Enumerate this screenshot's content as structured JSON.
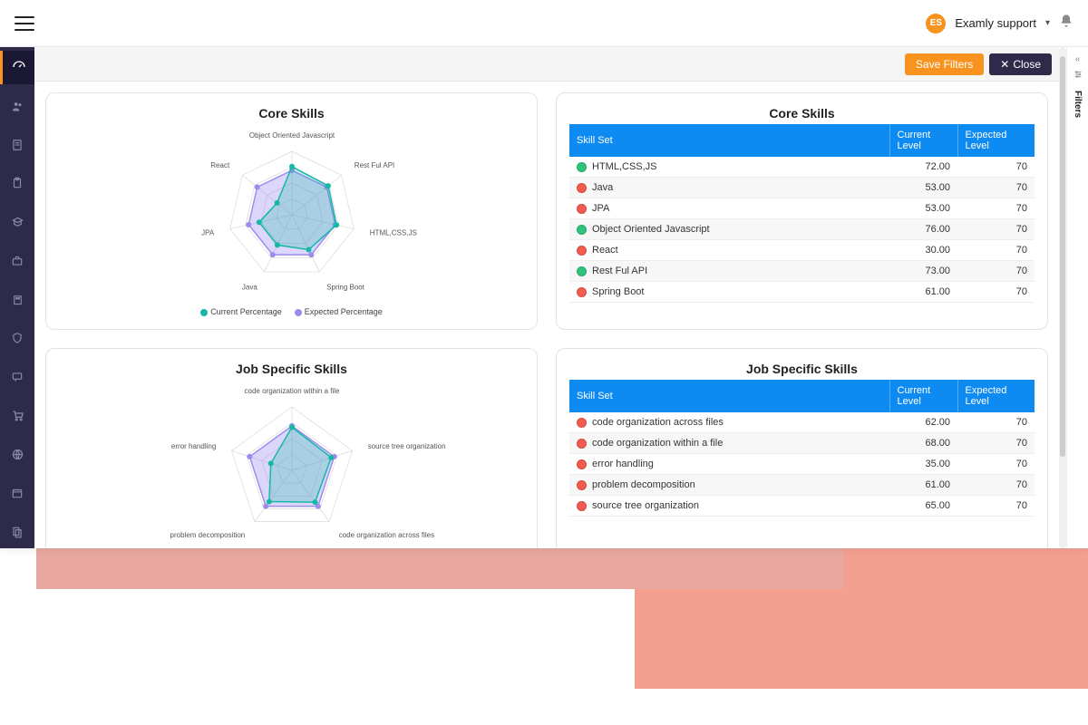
{
  "topbar": {
    "user_initials": "ES",
    "user_name": "Examly support"
  },
  "toolbar": {
    "save_label": "Save Filters",
    "close_label": "Close"
  },
  "filters_rail": {
    "label": "Filters"
  },
  "colors": {
    "current": "#15b8a6",
    "expected": "#9b8cf0",
    "header_blue": "#0d8bf2",
    "accent": "#f7931e",
    "sidebar": "#2e2b4a"
  },
  "legend": {
    "current": "Current Percentage",
    "expected": "Expected Percentage"
  },
  "core": {
    "title": "Core Skills",
    "table_title": "Core Skills",
    "headers": {
      "skill": "Skill Set",
      "current": "Current Level",
      "expected": "Expected Level"
    },
    "rows": [
      {
        "name": "HTML,CSS,JS",
        "current": 72.0,
        "expected": 70,
        "status": "green"
      },
      {
        "name": "Java",
        "current": 53.0,
        "expected": 70,
        "status": "red"
      },
      {
        "name": "JPA",
        "current": 53.0,
        "expected": 70,
        "status": "red"
      },
      {
        "name": "Object Oriented Javascript",
        "current": 76.0,
        "expected": 70,
        "status": "green"
      },
      {
        "name": "React",
        "current": 30.0,
        "expected": 70,
        "status": "red"
      },
      {
        "name": "Rest Ful API",
        "current": 73.0,
        "expected": 70,
        "status": "green"
      },
      {
        "name": "Spring Boot",
        "current": 61.0,
        "expected": 70,
        "status": "red"
      }
    ],
    "radar_order": [
      "Object Oriented Javascript",
      "Rest Ful API",
      "HTML,CSS,JS",
      "Spring Boot",
      "Java",
      "JPA",
      "React"
    ]
  },
  "job": {
    "title": "Job Specific Skills",
    "table_title": "Job Specific Skills",
    "headers": {
      "skill": "Skill Set",
      "current": "Current Level",
      "expected": "Expected Level"
    },
    "rows": [
      {
        "name": "code organization across files",
        "current": 62.0,
        "expected": 70,
        "status": "red"
      },
      {
        "name": "code organization within a file",
        "current": 68.0,
        "expected": 70,
        "status": "red"
      },
      {
        "name": "error handling",
        "current": 35.0,
        "expected": 70,
        "status": "red"
      },
      {
        "name": "problem decomposition",
        "current": 61.0,
        "expected": 70,
        "status": "red"
      },
      {
        "name": "source tree organization",
        "current": 65.0,
        "expected": 70,
        "status": "red"
      }
    ],
    "radar_order": [
      "code organization within a file",
      "source tree organization",
      "code organization across files",
      "problem decomposition",
      "error handling"
    ]
  },
  "chart_data": [
    {
      "type": "radar",
      "title": "Core Skills",
      "categories": [
        "Object Oriented Javascript",
        "Rest Ful API",
        "HTML,CSS,JS",
        "Spring Boot",
        "Java",
        "JPA",
        "React"
      ],
      "series": [
        {
          "name": "Current Percentage",
          "values": [
            76,
            73,
            72,
            61,
            53,
            53,
            30
          ]
        },
        {
          "name": "Expected Percentage",
          "values": [
            70,
            70,
            70,
            70,
            70,
            70,
            70
          ]
        }
      ],
      "range": [
        0,
        100
      ],
      "legend_position": "bottom"
    },
    {
      "type": "radar",
      "title": "Job Specific Skills",
      "categories": [
        "code organization within a file",
        "source tree organization",
        "code organization across files",
        "problem decomposition",
        "error handling"
      ],
      "series": [
        {
          "name": "Current Percentage",
          "values": [
            68,
            65,
            62,
            61,
            35
          ]
        },
        {
          "name": "Expected Percentage",
          "values": [
            70,
            70,
            70,
            70,
            70
          ]
        }
      ],
      "range": [
        0,
        100
      ],
      "legend_position": "bottom"
    }
  ]
}
